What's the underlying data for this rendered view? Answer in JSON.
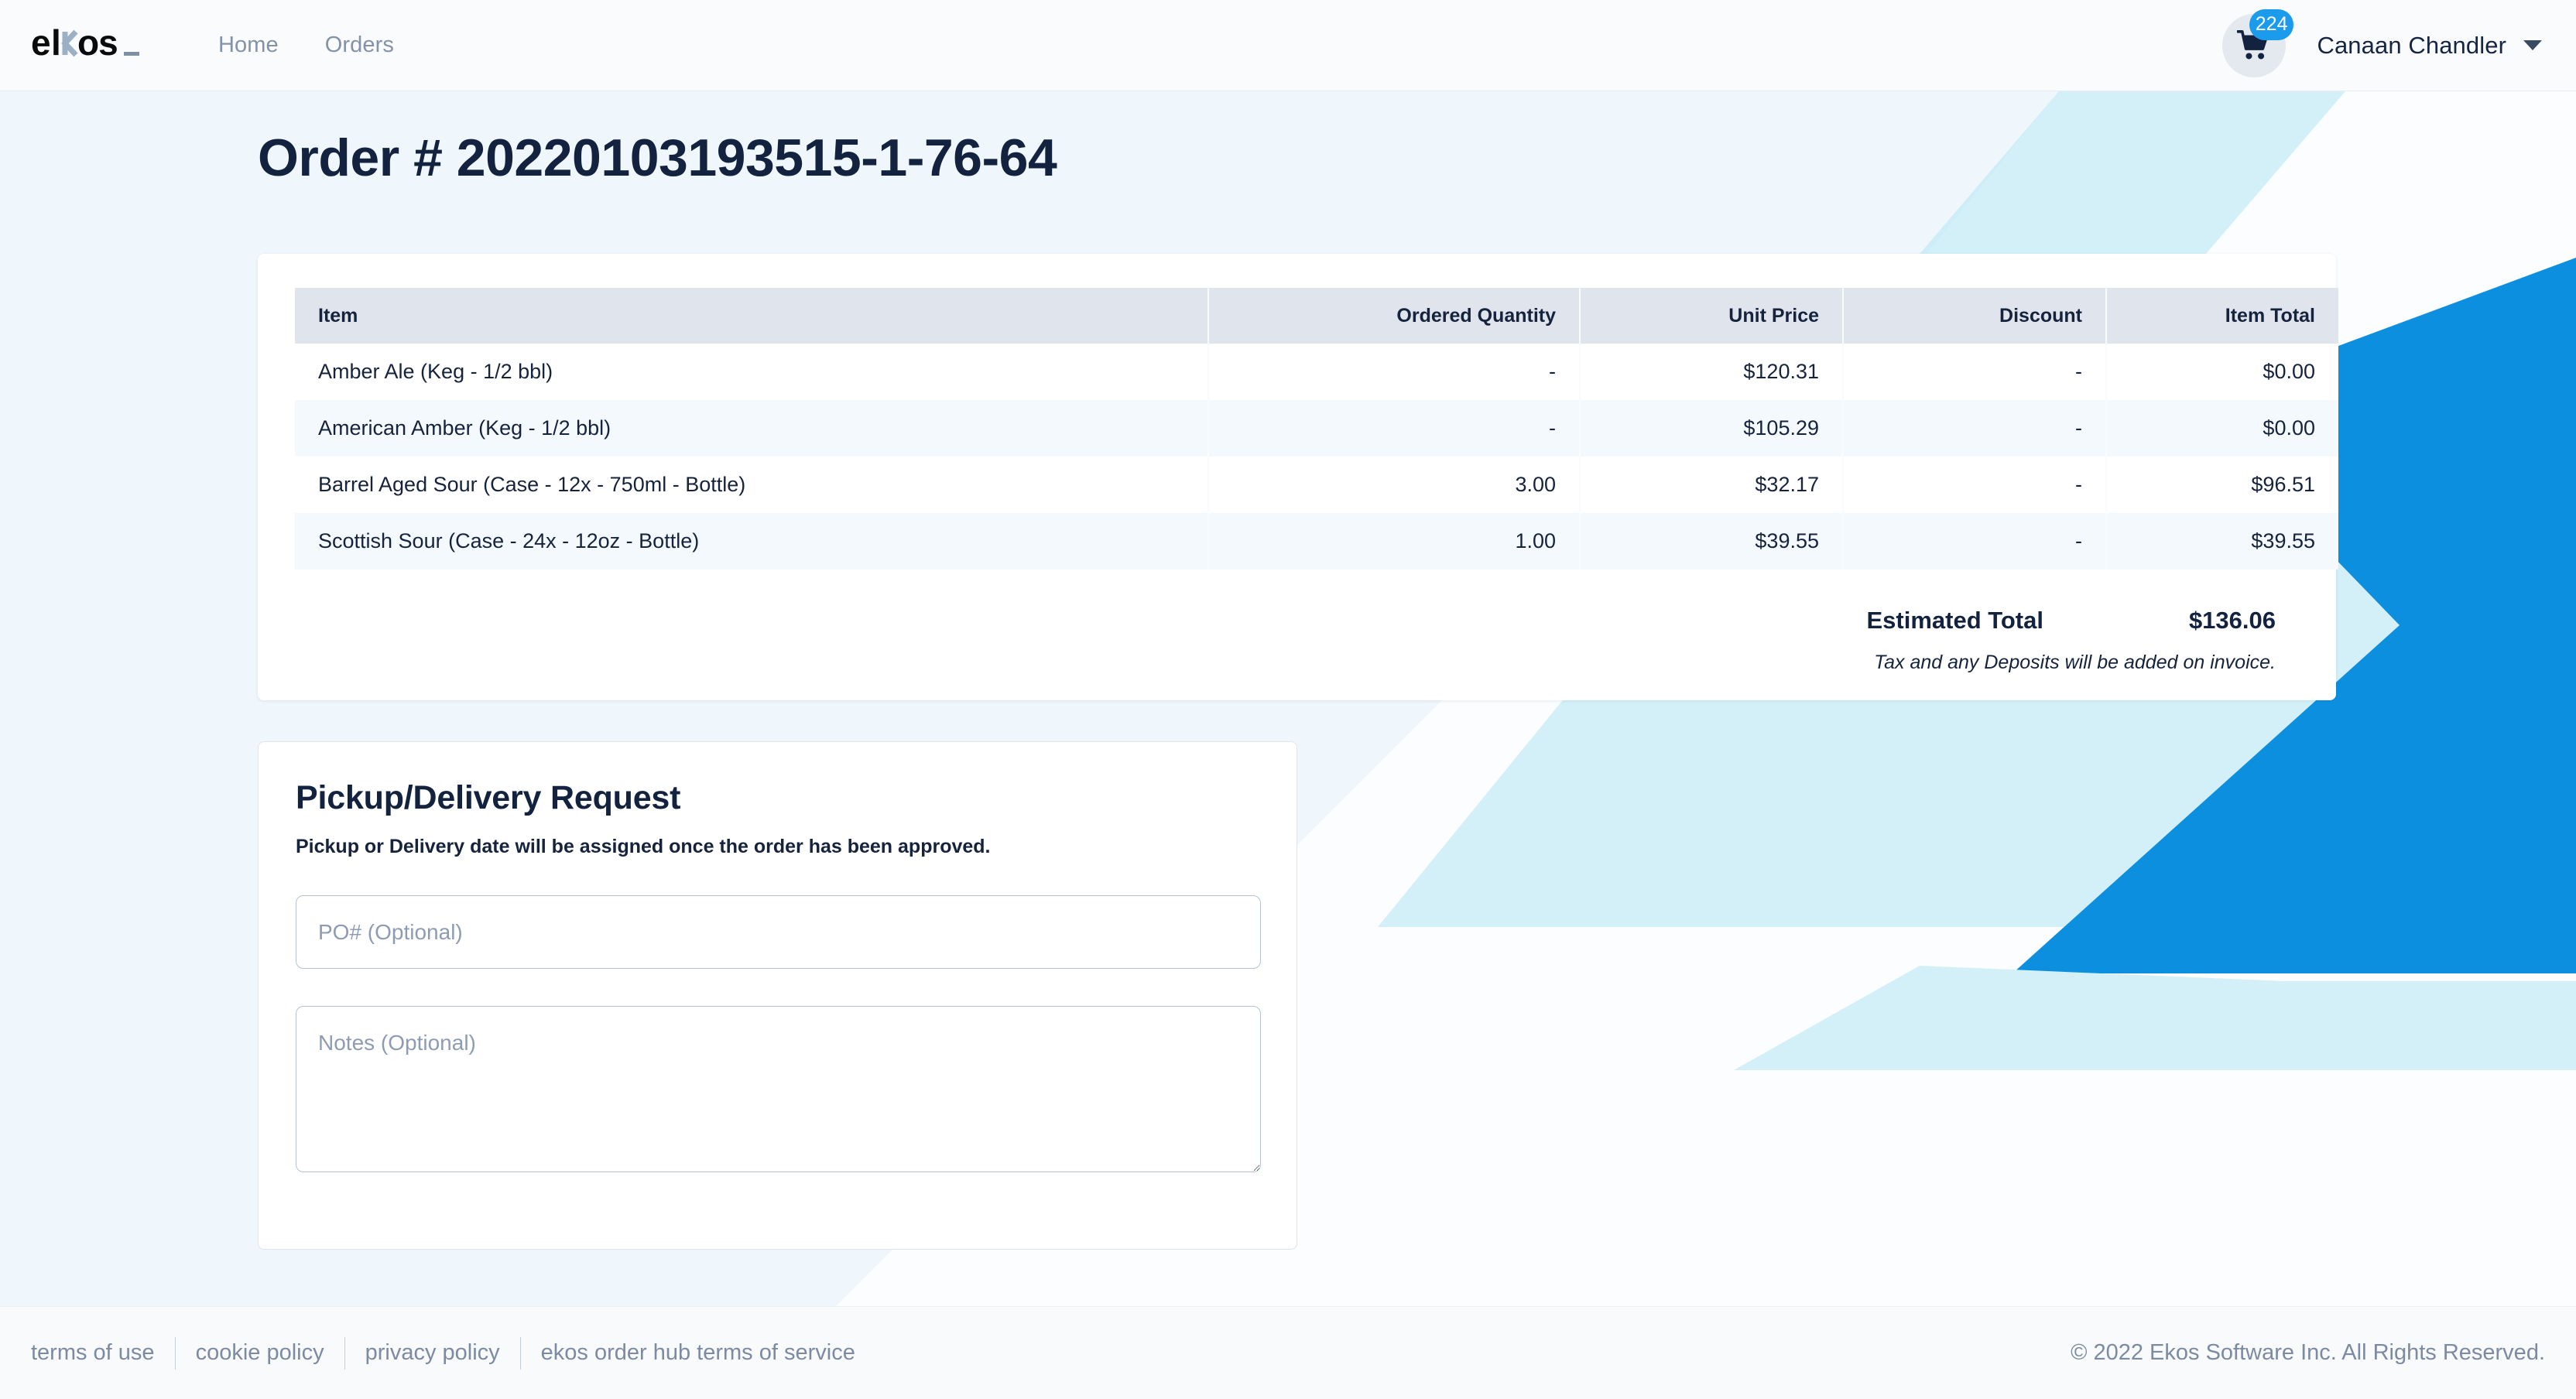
{
  "header": {
    "logo_text": "ekos",
    "nav": [
      {
        "label": "Home"
      },
      {
        "label": "Orders"
      }
    ],
    "cart": {
      "icon": "shopping-cart-icon",
      "badge_count": "224",
      "badge_color": "#1a9bec"
    },
    "user": {
      "name": "Canaan Chandler",
      "caret_icon": "chevron-down-icon"
    }
  },
  "page": {
    "title": "Order # 20220103193515-1-76-64"
  },
  "order_table": {
    "columns": [
      {
        "key": "item",
        "label": "Item",
        "align": "left"
      },
      {
        "key": "qty",
        "label": "Ordered Quantity",
        "align": "right"
      },
      {
        "key": "price",
        "label": "Unit Price",
        "align": "right"
      },
      {
        "key": "disc",
        "label": "Discount",
        "align": "right"
      },
      {
        "key": "total",
        "label": "Item Total",
        "align": "right"
      }
    ],
    "rows": [
      {
        "item": "Amber Ale (Keg - 1/2 bbl)",
        "qty": "-",
        "price": "$120.31",
        "disc": "-",
        "total": "$0.00"
      },
      {
        "item": "American Amber (Keg - 1/2 bbl)",
        "qty": "-",
        "price": "$105.29",
        "disc": "-",
        "total": "$0.00"
      },
      {
        "item": "Barrel Aged Sour (Case - 12x - 750ml - Bottle)",
        "qty": "3.00",
        "price": "$32.17",
        "disc": "-",
        "total": "$96.51"
      },
      {
        "item": "Scottish Sour (Case - 24x - 12oz - Bottle)",
        "qty": "1.00",
        "price": "$39.55",
        "disc": "-",
        "total": "$39.55"
      }
    ],
    "estimated_total_label": "Estimated Total",
    "estimated_total_value": "$136.06",
    "tax_note": "Tax and any Deposits will be added on invoice."
  },
  "pickup": {
    "title": "Pickup/Delivery Request",
    "subtitle": "Pickup or Delivery date will be assigned once the order has been approved.",
    "po_value": "",
    "po_placeholder": "PO# (Optional)",
    "notes_value": "",
    "notes_placeholder": "Notes (Optional)"
  },
  "footer": {
    "links": [
      {
        "label": "terms of use"
      },
      {
        "label": "cookie policy"
      },
      {
        "label": "privacy policy"
      },
      {
        "label": "ekos order hub terms of service"
      }
    ],
    "copyright": "© 2022 Ekos Software Inc. All Rights Reserved."
  },
  "theme": {
    "accent_blue": "#0d8fe0",
    "pale_cyan": "#cdeef7",
    "page_bg": "#eff6fc",
    "ink": "#13233f"
  }
}
